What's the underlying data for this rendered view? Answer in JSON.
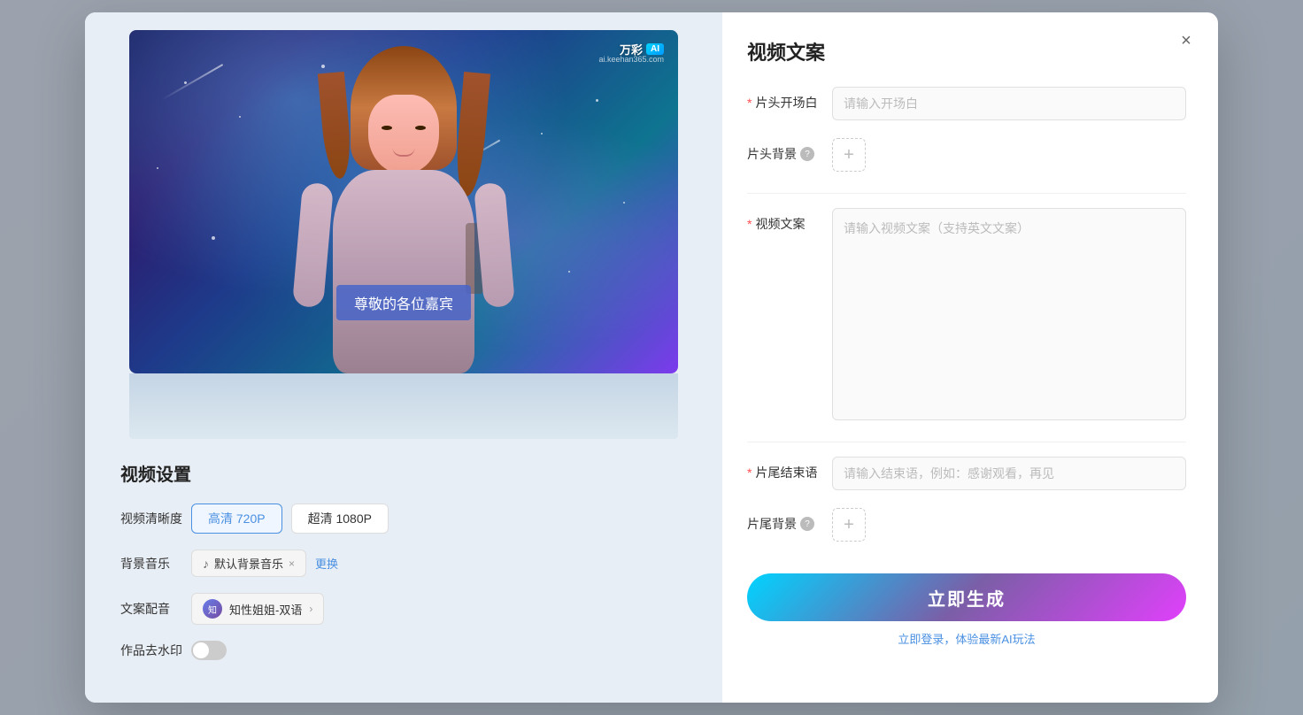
{
  "page": {
    "title": "视频文案"
  },
  "brand": {
    "name": "万彩",
    "ai_label": "AI",
    "url": "ai.keehan365.com"
  },
  "video_preview": {
    "caption": "尊敬的各位嘉宾"
  },
  "settings": {
    "title": "视频设置",
    "quality_label": "视频清晰度",
    "quality_options": [
      {
        "label": "高清 720P",
        "active": true
      },
      {
        "label": "超清 1080P",
        "active": false
      }
    ],
    "music_label": "背景音乐",
    "music_default": "默认背景音乐",
    "music_change": "更换",
    "voice_label": "文案配音",
    "voice_name": "知性姐姐-双语",
    "watermark_label": "作品去水印",
    "watermark_on": false
  },
  "form": {
    "title": "视频文案",
    "opening_label": "片头开场白",
    "opening_required": true,
    "opening_placeholder": "请输入开场白",
    "bg_start_label": "片头背景",
    "bg_start_help": true,
    "bg_start_btn": "+",
    "content_label": "视频文案",
    "content_required": true,
    "content_placeholder": "请输入视频文案（支持英文文案）",
    "ending_label": "片尾结束语",
    "ending_required": true,
    "ending_placeholder": "请输入结束语，例如：感谢观看，再见",
    "bg_end_label": "片尾背景",
    "bg_end_help": true,
    "bg_end_btn": "+",
    "generate_btn": "立即生成",
    "login_hint_text": "立即登录，体验最新AI玩法",
    "login_link_text": "立即登录"
  },
  "close_icon": "×"
}
